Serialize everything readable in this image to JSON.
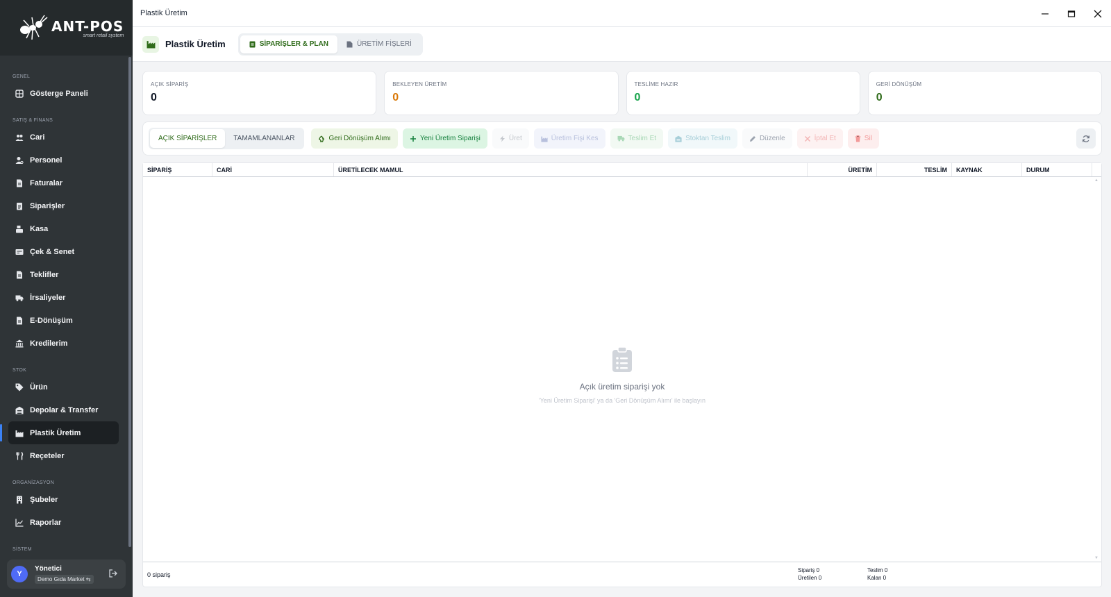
{
  "window": {
    "title": "Plastik Üretim"
  },
  "brand": {
    "name": "ANT-POS",
    "tagline": "smart retail system"
  },
  "sidebar": {
    "sections": {
      "genel": "GENEL",
      "satis": "SATIŞ & FİNANS",
      "stok": "STOK",
      "org": "ORGANİZASYON",
      "sistem": "SİSTEM"
    },
    "items": {
      "dashboard": "Gösterge Paneli",
      "cari": "Cari",
      "personel": "Personel",
      "faturalar": "Faturalar",
      "siparisler": "Siparişler",
      "kasa": "Kasa",
      "cek": "Çek & Senet",
      "teklifler": "Teklifler",
      "irsaliyeler": "İrsaliyeler",
      "edonusum": "E-Dönüşüm",
      "kredilerim": "Kredilerim",
      "urun": "Ürün",
      "depolar": "Depolar & Transfer",
      "plastik": "Plastik Üretim",
      "receteler": "Reçeteler",
      "subeler": "Şubeler",
      "raporlar": "Raporlar"
    },
    "user": {
      "initial": "Y",
      "name": "Yönetici",
      "store": "Demo Gıda Market"
    }
  },
  "header": {
    "title": "Plastik Üretim",
    "tabs": {
      "plan": "SİPARİŞLER & PLAN",
      "fisler": "ÜRETİM FİŞLERİ"
    }
  },
  "stats": {
    "acik": {
      "label": "AÇIK SİPARİŞ",
      "value": "0",
      "color": "#111827"
    },
    "bekleyen": {
      "label": "BEKLEYEN ÜRETİM",
      "value": "0",
      "color": "#d97706"
    },
    "teslime": {
      "label": "TESLİME HAZIR",
      "value": "0",
      "color": "#16a34a"
    },
    "geri": {
      "label": "GERİ DÖNÜŞÜM",
      "value": "0",
      "color": "#2f6b1a"
    }
  },
  "toolbar": {
    "seg_open": "AÇIK SİPARİŞLER",
    "seg_done": "TAMAMLANANLAR",
    "geri_donusum": "Geri Dönüşüm Alımı",
    "yeni_siparis": "Yeni Üretim Siparişi",
    "uret": "Üret",
    "fis_kes": "Üretim Fişi Kes",
    "teslim_et": "Teslim Et",
    "stoktan": "Stoktan Teslim",
    "duzenle": "Düzenle",
    "iptal": "İptal Et",
    "sil": "Sil"
  },
  "table": {
    "columns": {
      "siparis": "SİPARİŞ",
      "cari": "CARİ",
      "mamul": "ÜRETİLECEK MAMUL",
      "uretim": "ÜRETİM",
      "teslim": "TESLİM",
      "kaynak": "KAYNAK",
      "durum": "DURUM"
    },
    "empty_title": "Açık üretim siparişi yok",
    "empty_sub": "'Yeni Üretim Siparişi' ya da 'Geri Dönüşüm Alımı' ile başlayın",
    "footer_count": "0 sipariş",
    "sum_siparis": "Sipariş 0",
    "sum_uretilen": "Üretilen 0",
    "sum_teslim": "Teslim 0",
    "sum_kalan": "Kalan 0"
  }
}
